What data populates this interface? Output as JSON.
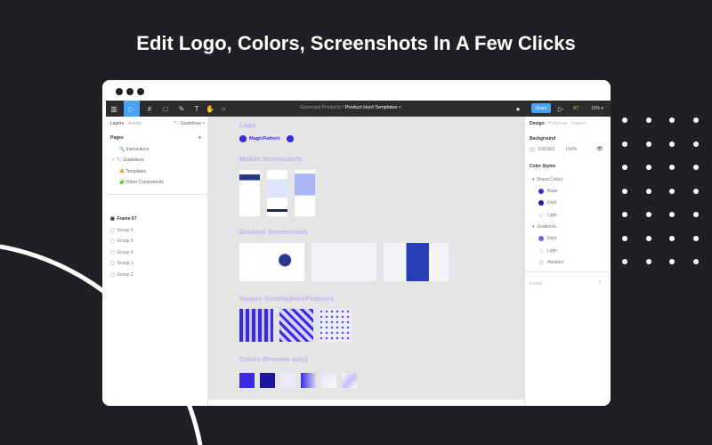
{
  "headline": "Edit Logo, Colors, Screenshots In A Few Clicks",
  "toolbar": {
    "breadcrumb_parent": "Gumroad Products",
    "breadcrumb_sep": "/",
    "file_name": "Product Hunt Templates",
    "share": "Share",
    "zoom": "19%"
  },
  "left_panel": {
    "tabs": [
      "Layers",
      "Assets"
    ],
    "page_select": "Guidelines",
    "pages_title": "Pages",
    "add": "+",
    "pages": [
      "Instructions",
      "Guidelines",
      "Templates",
      "Other Components"
    ],
    "layers": [
      "Frame 67",
      "Group 3",
      "Group 5",
      "Group 4",
      "Group 1",
      "Group 2"
    ]
  },
  "canvas": {
    "logo_title": "Logo",
    "logo_text": "MagicPattern",
    "mobile_title": "Mobile Screenshots",
    "desktop_title": "Desktop Screenshots",
    "square_title": "Square Screenshots/Features",
    "colors_title": "Colors (Preview only)"
  },
  "right_panel": {
    "tabs": [
      "Design",
      "Prototype",
      "Inspect"
    ],
    "background_title": "Background",
    "bg_hex": "E5E5E5",
    "bg_opacity": "100%",
    "color_styles_title": "Color Styles",
    "brand_group": "Brand Colors",
    "brand": [
      {
        "name": "Base",
        "color": "#3a2be3"
      },
      {
        "name": "Dark",
        "color": "#1f14a0"
      },
      {
        "name": "Light",
        "color": "#ecebfb"
      }
    ],
    "gradients_group": "Gradients",
    "gradients": [
      {
        "name": "Dark",
        "color": "#6b5ff0"
      },
      {
        "name": "Light",
        "color": "#eeedfb"
      },
      {
        "name": "Abstract",
        "color": "#e4e2fa"
      }
    ],
    "export": "Export"
  }
}
